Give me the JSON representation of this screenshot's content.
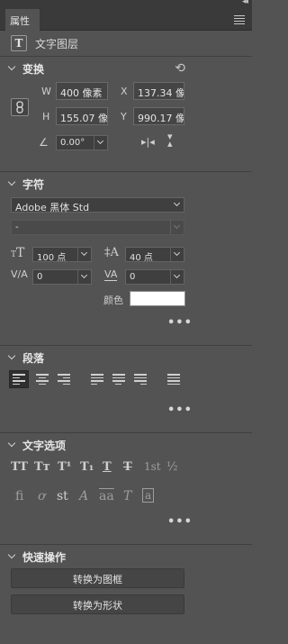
{
  "panel": {
    "tab_label": "属性"
  },
  "layer": {
    "type_icon": "T",
    "name": "文字图层"
  },
  "transform": {
    "title": "变换",
    "w_label": "W",
    "w_value": "400 像素",
    "x_label": "X",
    "x_value": "137.34 像",
    "h_label": "H",
    "h_value": "155.07 像",
    "y_label": "Y",
    "y_value": "990.17 像",
    "angle_value": "0.00°"
  },
  "character": {
    "title": "字符",
    "font_family": "Adobe 黑体 Std",
    "font_style": "-",
    "size_value": "100 点",
    "leading_value": "40 点",
    "kerning_value": "0",
    "tracking_value": "0",
    "color_label": "颜色",
    "color_value": "#ffffff",
    "more": "•••"
  },
  "paragraph": {
    "title": "段落",
    "more": "•••"
  },
  "text_options": {
    "title": "文字选项",
    "row1": [
      "TT",
      "Tт",
      "T¹",
      "T₁",
      "T",
      "T",
      "1st",
      "½"
    ],
    "row2": [
      "fi",
      "ơ",
      "st",
      "A",
      "aa",
      "T",
      "a"
    ],
    "more": "•••"
  },
  "quick_actions": {
    "title": "快速操作",
    "convert_frame": "转换为图框",
    "convert_shape": "转换为形状"
  },
  "colors": {
    "panel_bg": "#535353",
    "header_bg": "#3a3a3a"
  }
}
